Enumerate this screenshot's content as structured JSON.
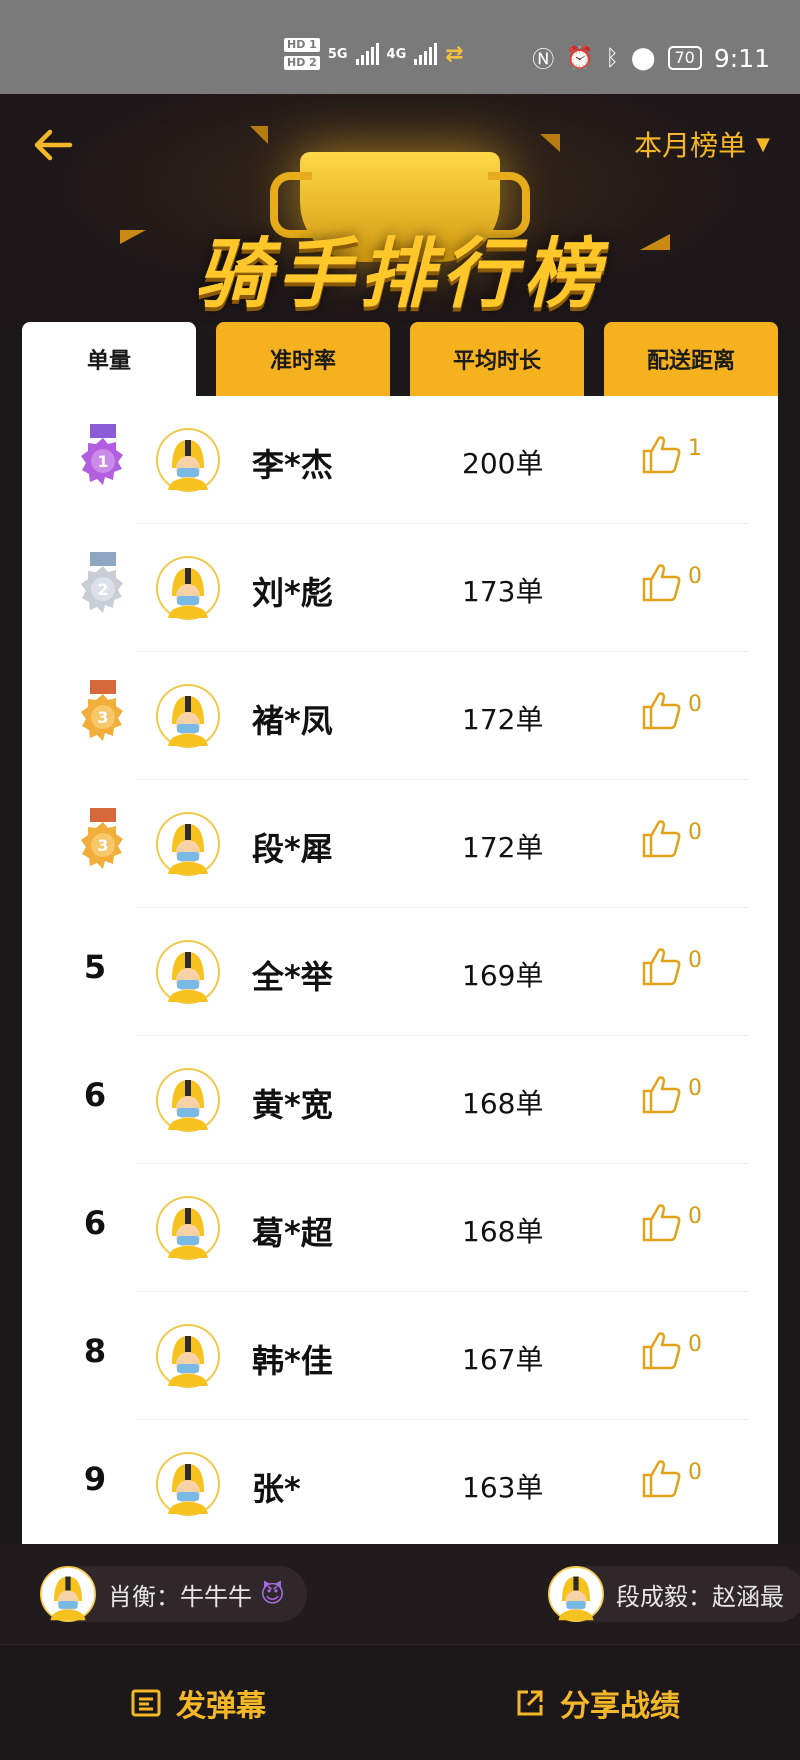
{
  "status_bar": {
    "hd1": "HD 1",
    "hd2": "HD 2",
    "net1": "5G",
    "net2": "4G",
    "battery": "70",
    "time": "9:11"
  },
  "header": {
    "title": "骑手排行榜",
    "period_selector": "本月榜单",
    "accent_color": "#f4b728"
  },
  "tabs": [
    {
      "label": "单量",
      "active": true
    },
    {
      "label": "准时率",
      "active": false
    },
    {
      "label": "平均时长",
      "active": false
    },
    {
      "label": "配送距离",
      "active": false
    }
  ],
  "rankings": [
    {
      "rank": "1",
      "medal": "purple",
      "name": "李*杰",
      "orders": "200单",
      "likes": "1"
    },
    {
      "rank": "2",
      "medal": "silver",
      "name": "刘*彪",
      "orders": "173单",
      "likes": "0"
    },
    {
      "rank": "3",
      "medal": "bronze",
      "name": "褚*凤",
      "orders": "172单",
      "likes": "0"
    },
    {
      "rank": "3",
      "medal": "bronze",
      "name": "段*犀",
      "orders": "172单",
      "likes": "0"
    },
    {
      "rank": "5",
      "medal": "",
      "name": "全*举",
      "orders": "169单",
      "likes": "0"
    },
    {
      "rank": "6",
      "medal": "",
      "name": "黄*宽",
      "orders": "168单",
      "likes": "0"
    },
    {
      "rank": "6",
      "medal": "",
      "name": "葛*超",
      "orders": "168单",
      "likes": "0"
    },
    {
      "rank": "8",
      "medal": "",
      "name": "韩*佳",
      "orders": "167单",
      "likes": "0"
    },
    {
      "rank": "9",
      "medal": "",
      "name": "张*",
      "orders": "163单",
      "likes": "0"
    }
  ],
  "barrage": [
    {
      "text": "肖衡：牛牛牛",
      "emoji": "😈"
    },
    {
      "text": "段成毅：赵涵最"
    }
  ],
  "bottom_bar": {
    "danmaku_label": "发弹幕",
    "share_label": "分享战绩"
  }
}
